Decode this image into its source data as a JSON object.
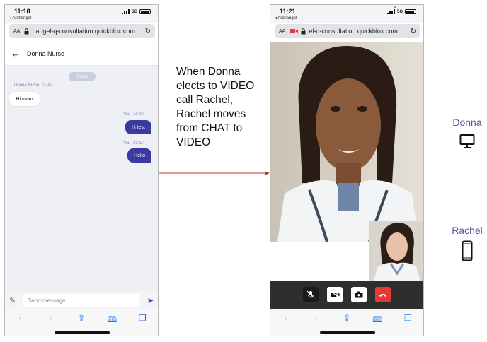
{
  "left_phone": {
    "status_time": "11:18",
    "status_back": "◂ Archangel",
    "network": "5G",
    "url_aa": "AA",
    "url": "hangel-q-consultation.quickblox.com",
    "chat_title": "Donna Nurse",
    "date_pill": "Today",
    "messages": [
      {
        "sender": "Donna Nurse",
        "time": "11:47",
        "text": "Hi mam",
        "direction": "in"
      },
      {
        "sender": "You",
        "time": "11:48",
        "text": "hi test",
        "direction": "out"
      },
      {
        "sender": "You",
        "time": "23:17",
        "text": "Hello",
        "direction": "out"
      }
    ],
    "composer_placeholder": "Send message"
  },
  "right_phone": {
    "status_time": "11:21",
    "status_back": "◂ Archangel",
    "network": "5G",
    "url_aa": "AA",
    "url": "el-q-consultation.quickblox.com"
  },
  "caption": "When Donna elects to VIDEO call Rachel, Rachel moves from CHAT to VIDEO",
  "devices": {
    "donna": {
      "label": "Donna",
      "icon": "desktop-monitor-icon"
    },
    "rachel": {
      "label": "Rachel",
      "icon": "mobile-phone-icon"
    }
  },
  "colors": {
    "accent": "#3b3aa0",
    "arrow": "#c0392b",
    "device_label": "#6d4aa8",
    "hangup": "#e53935"
  }
}
